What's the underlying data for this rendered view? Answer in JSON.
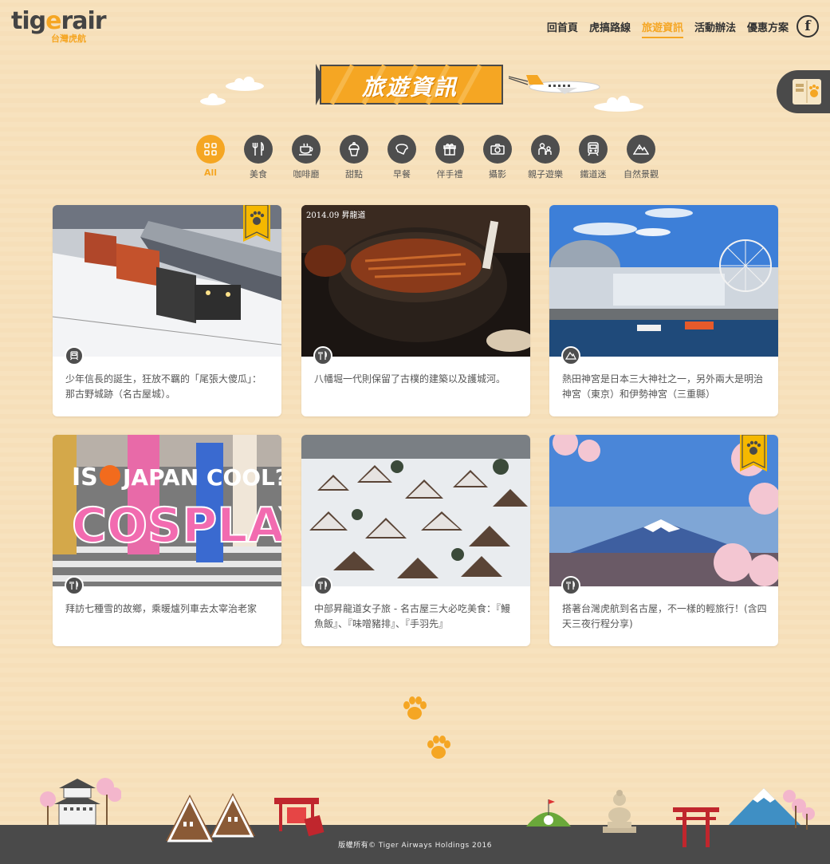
{
  "header": {
    "logo_text": "tigerair",
    "logo_sub": "台灣虎航",
    "nav": [
      {
        "label": "回首頁",
        "active": false
      },
      {
        "label": "虎搞路線",
        "active": false
      },
      {
        "label": "旅遊資訊",
        "active": true
      },
      {
        "label": "活動辦法",
        "active": false
      },
      {
        "label": "優惠方案",
        "active": false
      }
    ],
    "facebook_icon": "facebook-icon"
  },
  "banner": {
    "title": "旅遊資訊"
  },
  "categories": [
    {
      "label": "All",
      "icon": "grid-icon",
      "active": true
    },
    {
      "label": "美食",
      "icon": "fork-knife-icon",
      "active": false
    },
    {
      "label": "咖啡廳",
      "icon": "coffee-cup-icon",
      "active": false
    },
    {
      "label": "甜點",
      "icon": "cupcake-icon",
      "active": false
    },
    {
      "label": "早餐",
      "icon": "bread-icon",
      "active": false
    },
    {
      "label": "伴手禮",
      "icon": "gift-icon",
      "active": false
    },
    {
      "label": "攝影",
      "icon": "camera-icon",
      "active": false
    },
    {
      "label": "親子遊樂",
      "icon": "family-icon",
      "active": false
    },
    {
      "label": "鐵道迷",
      "icon": "train-icon",
      "active": false
    },
    {
      "label": "自然景觀",
      "icon": "mountain-icon",
      "active": false
    }
  ],
  "cards": [
    {
      "text": "少年信長的誕生，狂放不羈的「尾張大傻瓜」：那古野城跡（名古屋城）。",
      "icon": "train-icon",
      "ribbon": true,
      "image": "snowy-train-station"
    },
    {
      "text": "八幡堀一代則保留了古樸的建築以及護城河。",
      "icon": "fork-knife-icon",
      "ribbon": false,
      "image": "eel-rice-bowl",
      "caption": "2014.09 昇龍道"
    },
    {
      "text": "熱田神宮是日本三大神社之一，另外兩大是明治神宮（東京）和伊勢神宮（三重縣）",
      "icon": "mountain-icon",
      "ribbon": false,
      "image": "nagoya-port-ferris-wheel"
    },
    {
      "text": "拜訪七種雪的故鄉，乘暖爐列車去太宰治老家",
      "icon": "fork-knife-icon",
      "ribbon": false,
      "image": "cosplay-poster",
      "overlay_line1": "IS",
      "overlay_line1b": "JAPAN COOL?",
      "overlay_line2": "COSPLAY"
    },
    {
      "text": "中部昇龍道女子旅 - 名古屋三大必吃美食：『鰻魚飯』、『味噌豬排』、『手羽先』",
      "icon": "fork-knife-icon",
      "ribbon": false,
      "image": "shirakawa-go-village"
    },
    {
      "text": "搭著台灣虎航到名古屋，不一樣的輕旅行！(含四天三夜行程分享)",
      "icon": "fork-knife-icon",
      "ribbon": true,
      "image": "mount-fuji-cherry-blossom"
    }
  ],
  "footer": {
    "copyright": "版權所有© Tiger Airways Holdings 2016"
  },
  "colors": {
    "accent": "#f5a623",
    "background": "#f6dfb9",
    "dark": "#4a4a4a"
  }
}
